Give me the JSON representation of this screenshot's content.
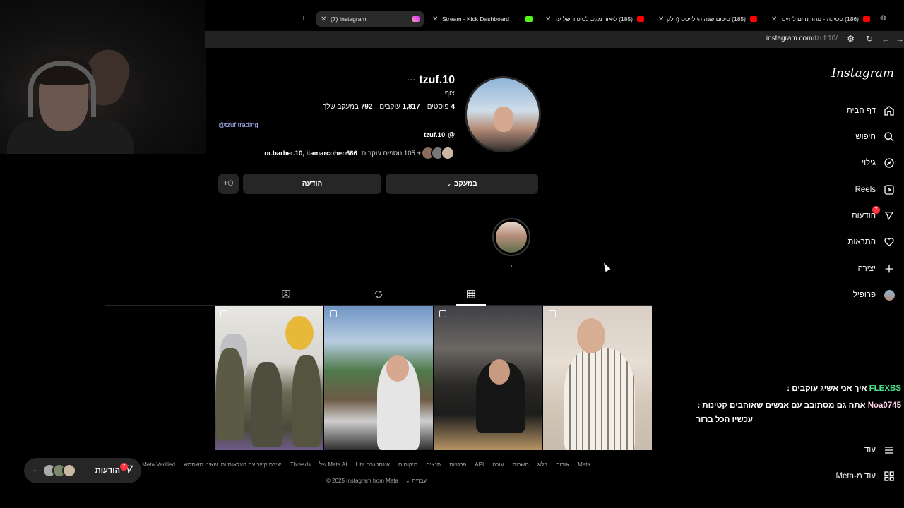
{
  "browser": {
    "tabs": [
      {
        "title": "(7) Instagram",
        "active": true
      },
      {
        "title": "Stream - Kick Dashboard",
        "active": false
      },
      {
        "title": "(185) ליאור מגיב לסיפור של עד",
        "active": false
      },
      {
        "title": "(185) סיכום שנה היילייטס (חלק",
        "active": false
      },
      {
        "title": "(186) סטילה - מחר נרים לחיים",
        "active": false
      }
    ],
    "url_host": "instagram.com",
    "url_path": "/tzuf.10/"
  },
  "nav": {
    "logo": "Instagram",
    "items": [
      {
        "label": "דף הבית",
        "icon": "home-icon"
      },
      {
        "label": "חיפוש",
        "icon": "search-icon"
      },
      {
        "label": "גילוי",
        "icon": "compass-icon"
      },
      {
        "label": "Reels",
        "icon": "reels-icon"
      },
      {
        "label": "הודעות",
        "icon": "messenger-icon",
        "badge": "7"
      },
      {
        "label": "התראות",
        "icon": "heart-icon"
      },
      {
        "label": "יצירה",
        "icon": "plus-icon"
      },
      {
        "label": "פרופיל",
        "icon": "profile-avatar-icon"
      }
    ],
    "more": "עוד",
    "meta_more": "עוד מ-Meta"
  },
  "profile": {
    "username": "tzuf.10",
    "full_name": "צוף",
    "posts_count": "4",
    "posts_label": "פוסטים",
    "followers_count": "1,817",
    "followers_label": "עוקבים",
    "following_count": "792",
    "following_label": "במעקב שלך",
    "link": "@tzuf.trading",
    "threads_handle": "tzuf.10",
    "followed_by_names": "or.barber.10, itamarcohen666",
    "followed_by_rest": "+ 105 נוספים עוקבים",
    "following_button": "במעקב",
    "message_button": "הודעה"
  },
  "footer": {
    "links": [
      "Meta",
      "אודות",
      "בלוג",
      "משרות",
      "עזרה",
      "API",
      "פרטיות",
      "תנאים",
      "מיקומים",
      "אינסטגרם Lite",
      "Meta AI של",
      "Threads",
      "יצירת קשר עם העלאות ומי שאינו משתמש",
      "Meta Verified",
      "הסכמי פשר"
    ],
    "language": "עברית",
    "copyright": "© 2025 Instagram from Meta"
  },
  "chat": [
    {
      "user": "FLEXBS",
      "message": "איך אני אשיג עוקבים :"
    },
    {
      "user": "Noa0745",
      "message": "אתה גם מסתובב עם אנשים שאוהבים קטינות :"
    },
    {
      "user": "",
      "message": "עכשיו הכל ברור"
    }
  ],
  "messages_pill": {
    "label": "הודעות",
    "badge": "7"
  },
  "colors": {
    "background": "#000000",
    "button": "#262626",
    "badge": "#ff3040",
    "chat_user": "#4fe08a",
    "link": "#b0b8ff"
  }
}
